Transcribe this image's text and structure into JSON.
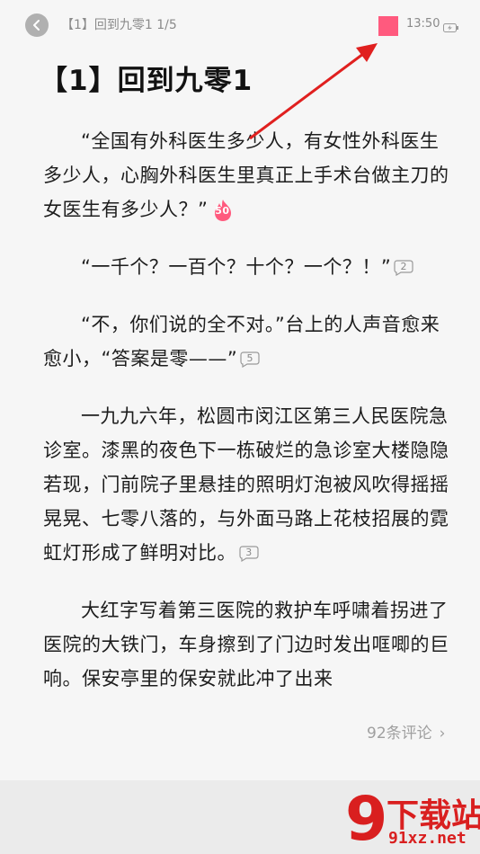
{
  "header": {
    "breadcrumb": "【1】回到九零1 1/5",
    "time": "13:50"
  },
  "chapter": {
    "title": "【1】回到九零1"
  },
  "paragraphs": [
    {
      "text": "“全国有外科医生多少人，有女性外科医生多少人，心胸外科医生里真正上手术台做主刀的女医生有多少人？”",
      "badge": "50",
      "badge_type": "hot"
    },
    {
      "text": "“一千个？一百个？十个？一个？！”",
      "badge": "2",
      "badge_type": "bubble"
    },
    {
      "text": "“不，你们说的全不对。”台上的人声音愈来愈小，“答案是零——”",
      "badge": "5",
      "badge_type": "bubble"
    },
    {
      "text": "一九九六年，松圆市闵江区第三人民医院急诊室。漆黑的夜色下一栋破烂的急诊室大楼隐隐若现，门前院子里悬挂的照明灯泡被风吹得摇摇晃晃、七零八落的，与外面马路上花枝招展的霓虹灯形成了鲜明对比。",
      "badge": "3",
      "badge_type": "bubble"
    },
    {
      "text": "大红字写着第三医院的救护车呼啸着拐进了医院的大铁门，车身擦到了门边时发出哐唧的巨响。保安亭里的保安就此冲了出来",
      "badge": null,
      "badge_type": null
    }
  ],
  "comments": {
    "label": "92条评论",
    "chevron": "›"
  },
  "watermark": {
    "logo_char": "9",
    "text": "下载站",
    "domain": "91xz.net"
  },
  "colors": {
    "background": "#f6f6f6",
    "bookmark": "#ff5a7e",
    "hot_badge": "#ff5a7e",
    "annotation_arrow": "#e0201f"
  }
}
